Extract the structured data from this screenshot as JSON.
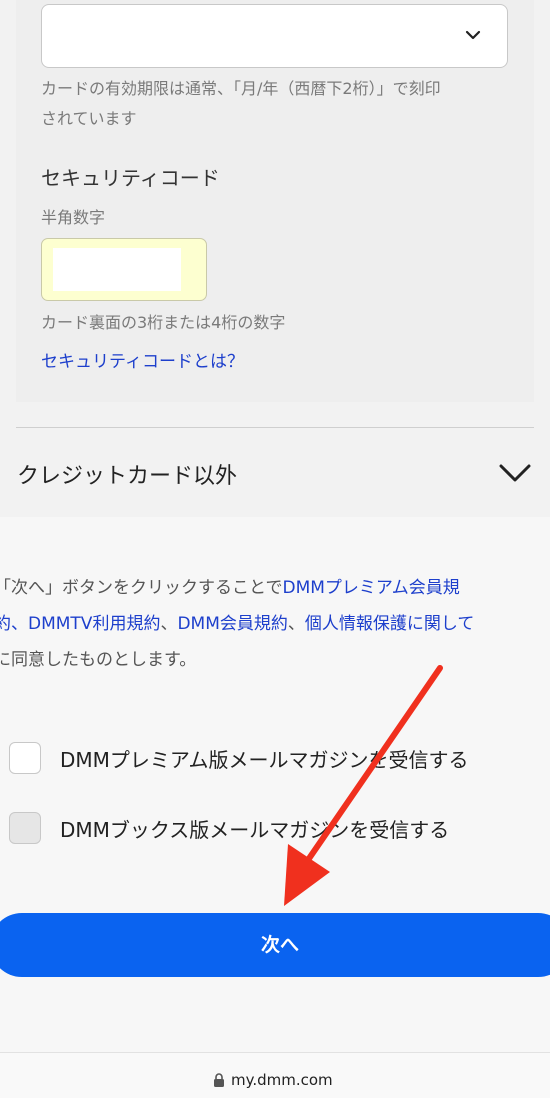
{
  "card": {
    "expiry_note_line1": "カードの有効期限は通常、「月/年（西暦下2桁）」で刻印",
    "expiry_note_line2": "されています",
    "security_label": "セキュリティコード",
    "security_hint": "半角数字",
    "security_value": "",
    "security_note": "カード裏面の3桁または4桁の数字",
    "security_link": "セキュリティコードとは？"
  },
  "other": {
    "label": "クレジットカード以外"
  },
  "terms": {
    "line1_prefix": "「次へ」ボタンをクリックすることで",
    "line1_link": "DMMプレミアム会員規",
    "line2_link_a": "約、DMMTV利用規約",
    "line2_sep1": "、",
    "line2_link_b": "DMM会員規約",
    "line2_sep2": "、",
    "line2_link_c": "個人情報保護に関して",
    "line3": "に同意したものとします。"
  },
  "newsletters": [
    {
      "label": "DMMプレミアム版メールマガジンを受信する",
      "checked": false
    },
    {
      "label": "DMMブックス版メールマガジンを受信する",
      "checked": false
    }
  ],
  "next_button": "次へ",
  "browser": {
    "url": "my.dmm.com"
  },
  "colors": {
    "accent": "#0a63f0",
    "link": "#1d3fcc",
    "annotation_arrow": "#f0301e"
  }
}
